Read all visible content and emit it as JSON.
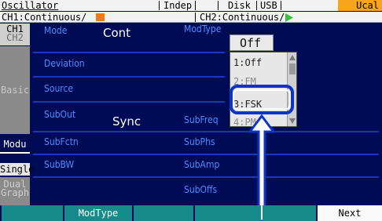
{
  "status_bar": {
    "title": "Oscillator",
    "mode": "Indep",
    "disk": "Disk",
    "usb": "USB",
    "ucal": "Ucal"
  },
  "channel_bar": {
    "ch1": "CH1:Continuous/",
    "ch2": "CH2:Continuous/"
  },
  "side_tabs": {
    "ch1": "CH1",
    "ch2": "CH2",
    "basic": "Basic",
    "modu": "Modu",
    "single": "Single",
    "dual": "Dual",
    "graph": "Graph"
  },
  "params_left": {
    "mode_label": "Mode",
    "mode_value": "Cont",
    "deviation_label": "Deviation",
    "source_label": "Source",
    "subout_label": "SubOut",
    "subout_value": "Sync",
    "subfctn_label": "SubFctn",
    "subbw_label": "SubBW"
  },
  "params_right": {
    "modtype_label": "ModType",
    "modtype_value": "Off",
    "subfreq_label": "SubFreq",
    "subphs_label": "SubPhs",
    "subamp_label": "SubAmp",
    "suboffs_label": "SubOffs"
  },
  "dropdown": {
    "options": [
      "1:Off",
      "2:FM",
      "3:FSK",
      "4:PM"
    ],
    "selected": "3:FSK"
  },
  "softkeys": [
    "",
    "ModType",
    "",
    "",
    "",
    "Next"
  ],
  "colors": {
    "background": "#000b56",
    "label_blue": "#4f8cff",
    "softkey_teal": "#16898a",
    "ucal_orange": "#f7a51c",
    "highlight_blue": "#0b34c9",
    "ch1_orange": "#f07a13",
    "ch2_green": "#38c23b"
  }
}
